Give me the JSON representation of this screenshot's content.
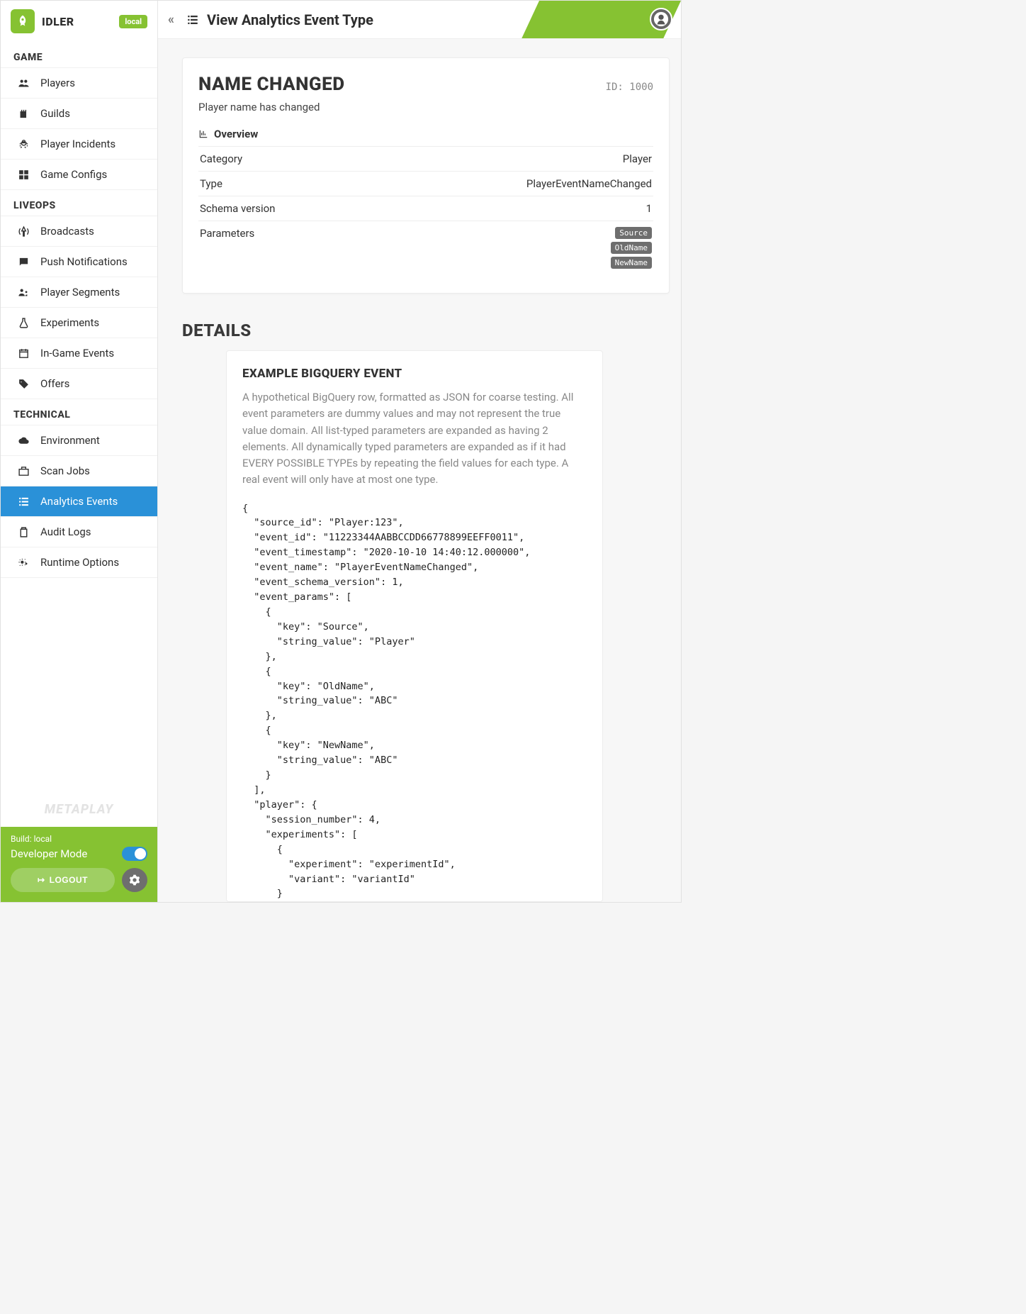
{
  "brand": {
    "name": "IDLER",
    "env_badge": "local"
  },
  "sidebar": {
    "sections": [
      {
        "title": "GAME",
        "items": [
          {
            "label": "Players",
            "icon": "users"
          },
          {
            "label": "Guilds",
            "icon": "castle"
          },
          {
            "label": "Player Incidents",
            "icon": "bug"
          },
          {
            "label": "Game Configs",
            "icon": "grid"
          }
        ]
      },
      {
        "title": "LIVEOPS",
        "items": [
          {
            "label": "Broadcasts",
            "icon": "antenna"
          },
          {
            "label": "Push Notifications",
            "icon": "chat"
          },
          {
            "label": "Player Segments",
            "icon": "segment"
          },
          {
            "label": "Experiments",
            "icon": "flask"
          },
          {
            "label": "In-Game Events",
            "icon": "calendar"
          },
          {
            "label": "Offers",
            "icon": "tag"
          }
        ]
      },
      {
        "title": "TECHNICAL",
        "items": [
          {
            "label": "Environment",
            "icon": "cloud"
          },
          {
            "label": "Scan Jobs",
            "icon": "toolbox"
          },
          {
            "label": "Analytics Events",
            "icon": "list",
            "active": true
          },
          {
            "label": "Audit Logs",
            "icon": "clipboard"
          },
          {
            "label": "Runtime Options",
            "icon": "gears"
          }
        ]
      }
    ],
    "footer": {
      "brand_footer": "METAPLAY",
      "build_label": "Build: local",
      "dev_mode_label": "Developer Mode",
      "dev_mode_on": true,
      "logout_label": "LOGOUT"
    }
  },
  "header": {
    "title": "View Analytics Event Type"
  },
  "event": {
    "name": "NAME CHANGED",
    "id_label": "ID: 1000",
    "description": "Player name has changed",
    "overview_label": "Overview",
    "rows": {
      "category": {
        "k": "Category",
        "v": "Player"
      },
      "type": {
        "k": "Type",
        "v": "PlayerEventNameChanged"
      },
      "schema": {
        "k": "Schema version",
        "v": "1"
      },
      "params": {
        "k": "Parameters"
      }
    },
    "parameters": [
      "Source",
      "OldName",
      "NewName"
    ]
  },
  "details": {
    "heading": "DETAILS",
    "card_title": "EXAMPLE BIGQUERY EVENT",
    "card_desc": "A hypothetical BigQuery row, formatted as JSON for coarse testing. All event parameters are dummy values and may not represent the true value domain. All list-typed parameters are expanded as having 2 elements. All dynamically typed parameters are expanded as if it had EVERY POSSIBLE TYPEs by repeating the field values for each type. A real event will only have at most one type.",
    "code": "{\n  \"source_id\": \"Player:123\",\n  \"event_id\": \"11223344AABBCCDD66778899EEFF0011\",\n  \"event_timestamp\": \"2020-10-10 14:40:12.000000\",\n  \"event_name\": \"PlayerEventNameChanged\",\n  \"event_schema_version\": 1,\n  \"event_params\": [\n    {\n      \"key\": \"Source\",\n      \"string_value\": \"Player\"\n    },\n    {\n      \"key\": \"OldName\",\n      \"string_value\": \"ABC\"\n    },\n    {\n      \"key\": \"NewName\",\n      \"string_value\": \"ABC\"\n    }\n  ],\n  \"player\": {\n    \"session_number\": 4,\n    \"experiments\": [\n      {\n        \"experiment\": \"experimentId\",\n        \"variant\": \"variantId\"\n      }"
  }
}
